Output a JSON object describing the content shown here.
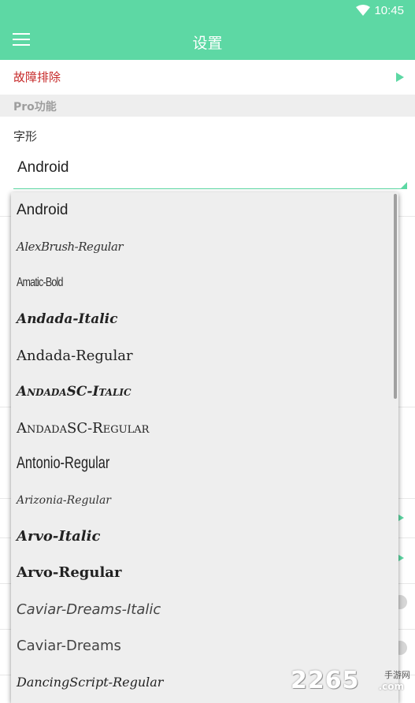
{
  "status_bar": {
    "time": "10:45",
    "icons": [
      "wifi-icon"
    ]
  },
  "app_bar": {
    "title": "设置",
    "menu_icon": "menu-icon"
  },
  "troubleshoot": {
    "label": "故障排除",
    "accent": "#c62828"
  },
  "pro_section": {
    "label": "Pro功能"
  },
  "font_setting": {
    "label": "字形",
    "value": "Android"
  },
  "font_options": [
    "Android",
    "AlexBrush-Regular",
    "Amatic-Bold",
    "Andada-Italic",
    "Andada-Regular",
    "AndadaSC-Italic",
    "AndadaSC-Regular",
    "Antonio-Regular",
    "Arizonia-Regular",
    "Arvo-Italic",
    "Arvo-Regular",
    "Caviar-Dreams-Italic",
    "Caviar-Dreams",
    "DancingScript-Regular"
  ],
  "watermark": {
    "main": "2265",
    "sub": "手游网",
    "suffix": ".com"
  },
  "colors": {
    "primary": "#5dd8a4",
    "dropdown_bg": "#eeeeee",
    "text": "#222222"
  }
}
